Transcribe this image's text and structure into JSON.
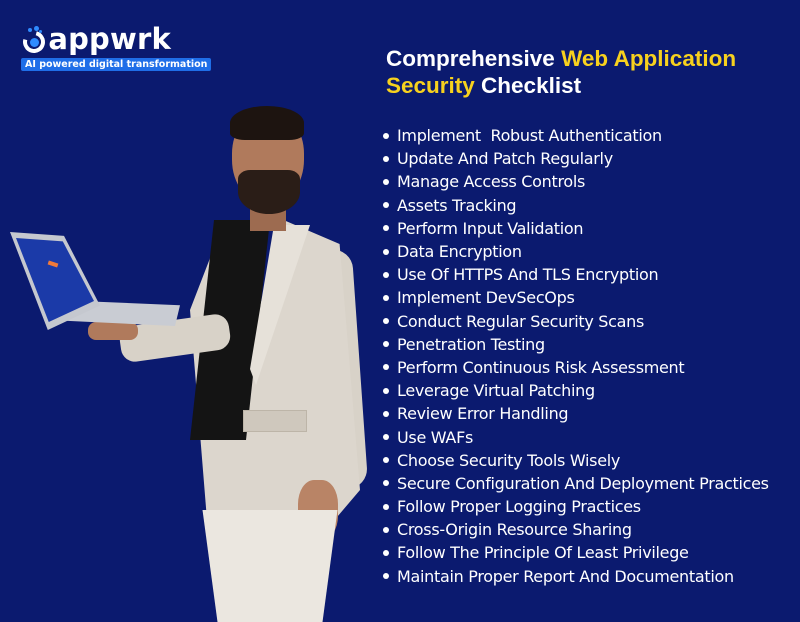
{
  "brand": {
    "name": "appwrk",
    "tagline": "AI powered digital transformation",
    "colors": {
      "background": "#0b1a6f",
      "accent_yellow": "#f7d11e",
      "brand_blue": "#1f6ee8",
      "text": "#ffffff"
    }
  },
  "title": {
    "part1": "Comprehensive ",
    "part2_highlight": "Web Application",
    "part3_highlight": "Security",
    "part4": " Checklist"
  },
  "checklist": [
    "Implement  Robust Authentication",
    "Update And Patch Regularly",
    "Manage Access Controls",
    "Assets Tracking",
    "Perform Input Validation",
    "Data Encryption",
    "Use Of HTTPS And TLS Encryption",
    "Implement DevSecOps",
    "Conduct Regular Security Scans",
    "Penetration Testing",
    "Perform Continuous Risk Assessment",
    "Leverage Virtual Patching",
    "Review Error Handling",
    "Use WAFs",
    "Choose Security Tools Wisely",
    "Secure Configuration And Deployment Practices",
    "Follow Proper Logging Practices",
    "Cross-Origin Resource Sharing",
    "Follow The Principle Of Least Privilege",
    "Maintain Proper Report And Documentation"
  ],
  "illustration": {
    "subject": "man in light suit holding open laptop",
    "icons": [
      "logo-mark-icon",
      "bullet-icon",
      "laptop-icon"
    ]
  }
}
